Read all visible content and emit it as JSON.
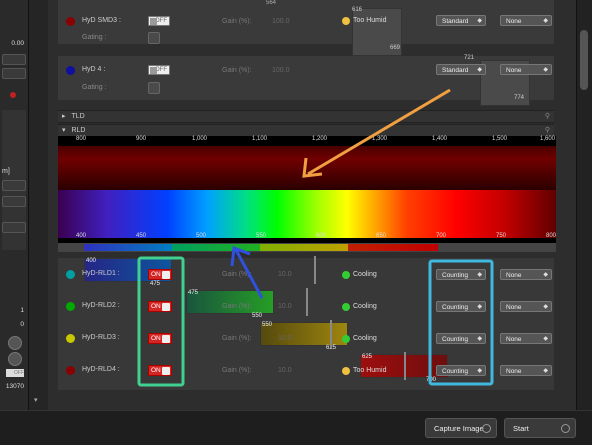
{
  "left": {
    "values": [
      "0.00",
      "1",
      "0",
      "0",
      "13070"
    ],
    "unit_fragment": "m]",
    "toggle_off": "OFF"
  },
  "top_section": {
    "rows": [
      {
        "label": "HyD SMD3 :",
        "dot_color": "#8b0000",
        "toggle": "OFF",
        "gain_label": "Gain (%):",
        "gain": "100.0",
        "status": "Too Humid",
        "status_color": "#f0c040",
        "mode": "Standard",
        "assign": "None",
        "gating_label": "Gating :",
        "hist_nums": [
          "564",
          "616",
          "669"
        ]
      },
      {
        "label": "HyD 4 :",
        "dot_color": "#1010a0",
        "toggle": "OFF",
        "gain_label": "Gain (%):",
        "gain": "100.0",
        "status": "",
        "status_color": "",
        "mode": "Standard",
        "assign": "None",
        "gating_label": "Gating :",
        "hist_nums": [
          "721",
          "774"
        ]
      }
    ]
  },
  "tld": {
    "label": "TLD"
  },
  "rld": {
    "label": "RLD"
  },
  "spectrum": {
    "top_ticks": [
      "800",
      "900",
      "1,000",
      "1,100",
      "1,200",
      "1,300",
      "1,400",
      "1,500",
      "1,600"
    ],
    "bottom_ticks": [
      "400",
      "450",
      "500",
      "550",
      "600",
      "650",
      "700",
      "750",
      "800"
    ]
  },
  "rld_rows": [
    {
      "label": "HyD-RLD1 :",
      "dot_color": "#00a0a0",
      "toggle": "ON",
      "gain_label": "Gain (%):",
      "gain": "10.0",
      "status": "Cooling",
      "status_color": "#33cc33",
      "mode": "Counting",
      "assign": "None",
      "range": [
        "400",
        "475"
      ]
    },
    {
      "label": "HyD-RLD2 :",
      "dot_color": "#00aa00",
      "toggle": "ON",
      "gain_label": "Gain (%):",
      "gain": "10.0",
      "status": "Cooling",
      "status_color": "#33cc33",
      "mode": "Counting",
      "assign": "None",
      "range": [
        "475",
        "550"
      ]
    },
    {
      "label": "HyD-RLD3 :",
      "dot_color": "#c8c800",
      "toggle": "ON",
      "gain_label": "Gain (%):",
      "gain": "10.0",
      "status": "Cooling",
      "status_color": "#33cc33",
      "mode": "Counting",
      "assign": "None",
      "range": [
        "550",
        "625"
      ]
    },
    {
      "label": "HyD-RLD4 :",
      "dot_color": "#8b0000",
      "toggle": "ON",
      "gain_label": "Gain (%):",
      "gain": "10.0",
      "status": "Too Humid",
      "status_color": "#f0c040",
      "mode": "Counting",
      "assign": "None",
      "range": [
        "625",
        "700"
      ]
    }
  ],
  "buttons": {
    "capture": "Capture Image",
    "start": "Start"
  },
  "annotations": {
    "orange": "#f0a040",
    "blue": "#3050e0",
    "green_box": "#40d090",
    "cyan_box": "#40b8e0"
  }
}
